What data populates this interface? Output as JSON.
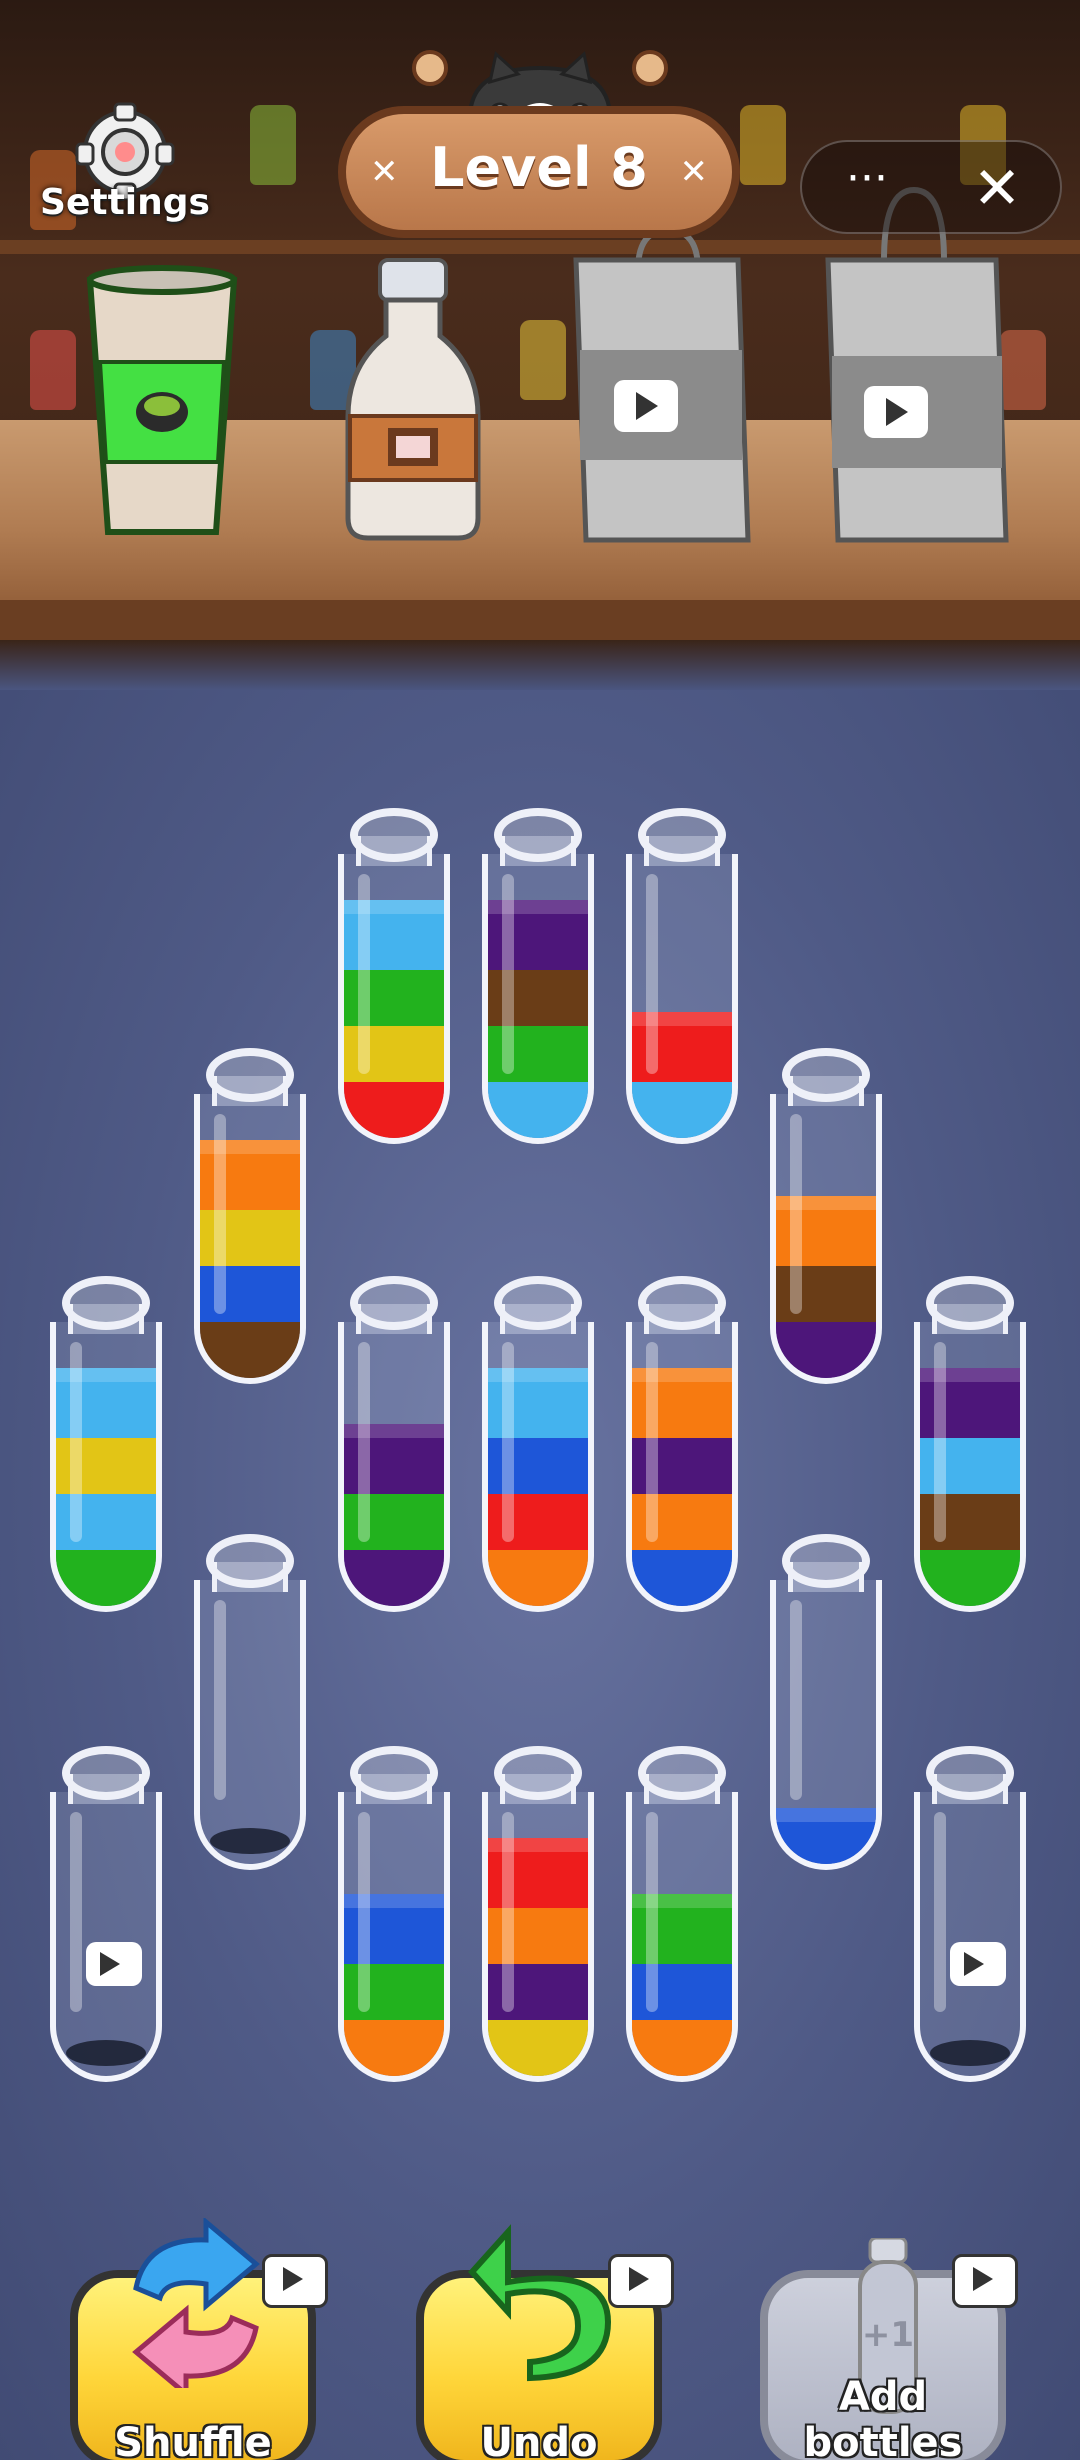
{
  "header": {
    "settings_label": "Settings",
    "level_label": "Level 8",
    "more_label": "···",
    "close_label": "✕"
  },
  "shop_items": [
    {
      "name": "matcha-cup",
      "locked": false
    },
    {
      "name": "chocolate-bottle",
      "locked": false
    },
    {
      "name": "gift-bag-1",
      "locked": true
    },
    {
      "name": "gift-bag-2",
      "locked": true
    }
  ],
  "colors": {
    "red": "#ee1c1c",
    "orange": "#f77a10",
    "yellow": "#e2c516",
    "green": "#22b21e",
    "lightblue": "#44b3ee",
    "blue": "#1e56d8",
    "purple": "#4d167a",
    "brown": "#6a3d17"
  },
  "tubes": [
    {
      "id": 1,
      "layers": [
        "red",
        "yellow",
        "green",
        "lightblue"
      ],
      "locked": false
    },
    {
      "id": 2,
      "layers": [
        "lightblue",
        "green",
        "brown",
        "purple"
      ],
      "locked": false
    },
    {
      "id": 3,
      "layers": [
        "lightblue",
        "red"
      ],
      "locked": false
    },
    {
      "id": 4,
      "layers": [
        "brown",
        "blue",
        "yellow",
        "orange"
      ],
      "locked": false
    },
    {
      "id": 5,
      "layers": [
        "purple",
        "brown",
        "orange"
      ],
      "locked": false
    },
    {
      "id": 6,
      "layers": [
        "green",
        "lightblue",
        "yellow",
        "lightblue"
      ],
      "locked": false
    },
    {
      "id": 7,
      "layers": [
        "purple",
        "green",
        "purple"
      ],
      "locked": false
    },
    {
      "id": 8,
      "layers": [
        "orange",
        "red",
        "blue",
        "lightblue"
      ],
      "locked": false
    },
    {
      "id": 9,
      "layers": [
        "blue",
        "orange",
        "purple",
        "orange"
      ],
      "locked": false
    },
    {
      "id": 10,
      "layers": [
        "green",
        "brown",
        "lightblue",
        "purple"
      ],
      "locked": false
    },
    {
      "id": 11,
      "layers": [],
      "locked": false
    },
    {
      "id": 12,
      "layers": [
        "blue"
      ],
      "locked": false
    },
    {
      "id": 13,
      "layers": [],
      "locked": true
    },
    {
      "id": 14,
      "layers": [
        "orange",
        "green",
        "blue"
      ],
      "locked": false
    },
    {
      "id": 15,
      "layers": [
        "yellow",
        "purple",
        "orange",
        "red"
      ],
      "locked": false
    },
    {
      "id": 16,
      "layers": [
        "orange",
        "blue",
        "green"
      ],
      "locked": false
    },
    {
      "id": 17,
      "layers": [],
      "locked": true
    }
  ],
  "buttons": {
    "shuffle_label": "Shuffle",
    "undo_label": "Undo",
    "add_bottles_label": "Add bottles",
    "add_bottles_badge": "+1"
  }
}
